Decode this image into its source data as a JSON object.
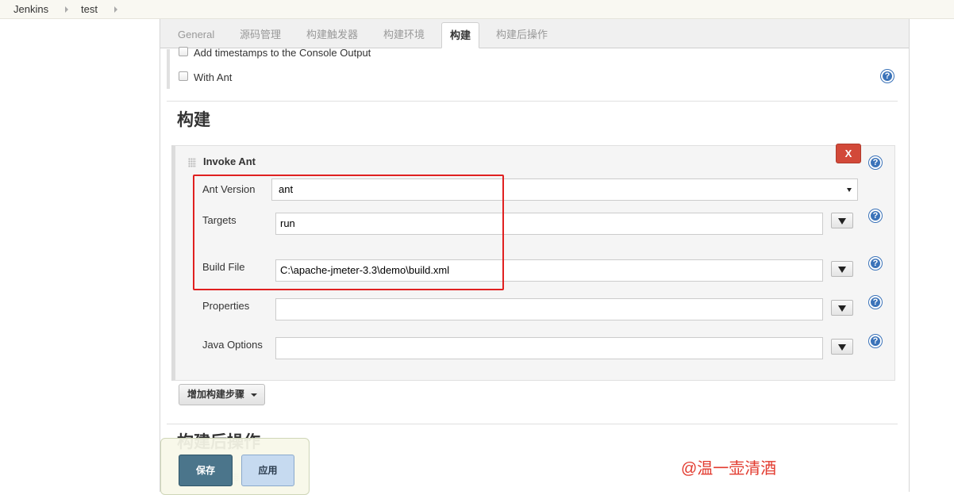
{
  "breadcrumb": [
    "Jenkins",
    "test"
  ],
  "tabs": [
    {
      "label": "General",
      "active": false
    },
    {
      "label": "源码管理",
      "active": false
    },
    {
      "label": "构建触发器",
      "active": false
    },
    {
      "label": "构建环境",
      "active": false
    },
    {
      "label": "构建",
      "active": true
    },
    {
      "label": "构建后操作",
      "active": false
    }
  ],
  "build_env": {
    "timestamps_label": "Add timestamps to the Console Output",
    "timestamps_checked": false,
    "with_ant_label": "With Ant",
    "with_ant_checked": false
  },
  "build_section": {
    "title": "构建",
    "step": {
      "title": "Invoke Ant",
      "delete_label": "X",
      "fields": {
        "ant_version": {
          "label": "Ant Version",
          "value": "ant"
        },
        "targets": {
          "label": "Targets",
          "value": "run"
        },
        "build_file": {
          "label": "Build File",
          "value": "C:\\apache-jmeter-3.3\\demo\\build.xml"
        },
        "properties": {
          "label": "Properties",
          "value": ""
        },
        "java_options": {
          "label": "Java Options",
          "value": ""
        }
      }
    },
    "add_step_label": "增加构建步骤"
  },
  "post_build": {
    "title": "构建后操作",
    "hidden_item_fragment": "毒"
  },
  "buttons": {
    "save": "保存",
    "apply": "应用"
  },
  "help_glyph": "?",
  "watermark": "@温一壶清酒",
  "colors": {
    "delete_button": "#d24939",
    "save_button": "#4b758b",
    "apply_button": "#c6daf0",
    "help_icon": "#3b73b9",
    "highlight_box": "#e02020",
    "watermark": "#e23a2e"
  }
}
